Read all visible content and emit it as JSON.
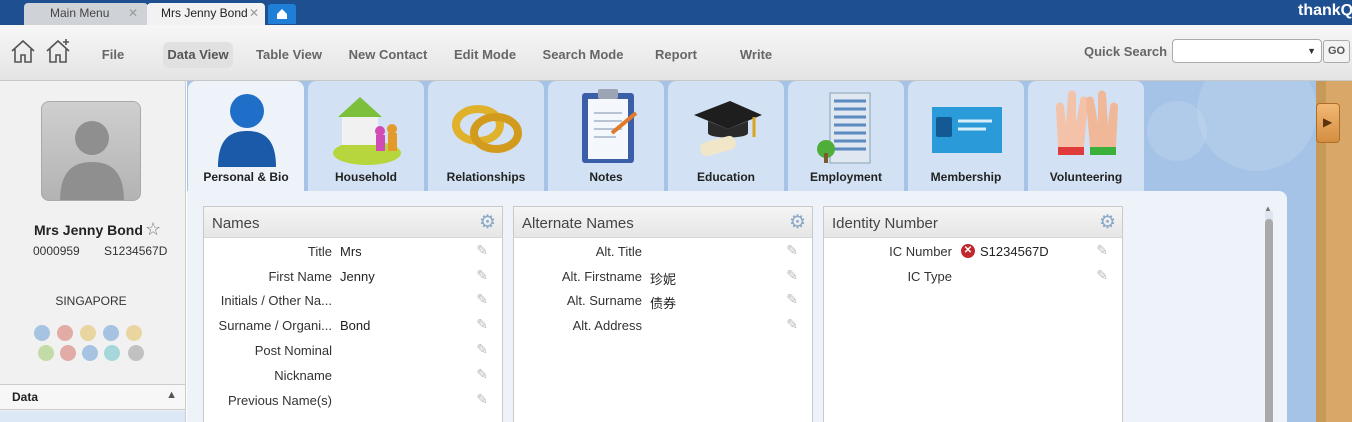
{
  "tabs": {
    "main": "Main Menu",
    "active": "Mrs Jenny Bond",
    "close_glyph": "✕"
  },
  "brand": "thankQ",
  "toolbar": {
    "items": [
      "File",
      "Data View",
      "Table View",
      "New Contact",
      "Edit Mode",
      "Search Mode",
      "Report",
      "Write"
    ],
    "active": "Data View",
    "quick_search_label": "Quick Search",
    "quick_search_value": "",
    "go_label": "GO"
  },
  "contact": {
    "name": "Mrs Jenny Bond",
    "id": "0000959",
    "ic": "S1234567D",
    "country": "SINGAPORE"
  },
  "left": {
    "data_section": "Data"
  },
  "categories": [
    "Personal & Bio",
    "Household",
    "Relationships",
    "Notes",
    "Education",
    "Employment",
    "Membership",
    "Volunteering"
  ],
  "active_category": "Personal & Bio",
  "cards": {
    "names": {
      "title": "Names",
      "rows": [
        {
          "label": "Title",
          "value": "Mrs"
        },
        {
          "label": "First Name",
          "value": "Jenny"
        },
        {
          "label": "Initials / Other Na...",
          "value": ""
        },
        {
          "label": "Surname / Organi...",
          "value": "Bond"
        },
        {
          "label": "Post Nominal",
          "value": ""
        },
        {
          "label": "Nickname",
          "value": ""
        },
        {
          "label": "Previous Name(s)",
          "value": ""
        }
      ]
    },
    "alternate": {
      "title": "Alternate Names",
      "rows": [
        {
          "label": "Alt. Title",
          "value": ""
        },
        {
          "label": "Alt. Firstname",
          "value": "珍妮"
        },
        {
          "label": "Alt. Surname",
          "value": "债券"
        },
        {
          "label": "Alt. Address",
          "value": ""
        }
      ]
    },
    "identity": {
      "title": "Identity Number",
      "rows": [
        {
          "label": "IC Number",
          "value": "S1234567D"
        },
        {
          "label": "IC Type",
          "value": ""
        }
      ]
    }
  },
  "colors": {
    "titlebar": "#1d4f91",
    "main_bg": "#a5c3e6",
    "error": "#c0282d"
  }
}
